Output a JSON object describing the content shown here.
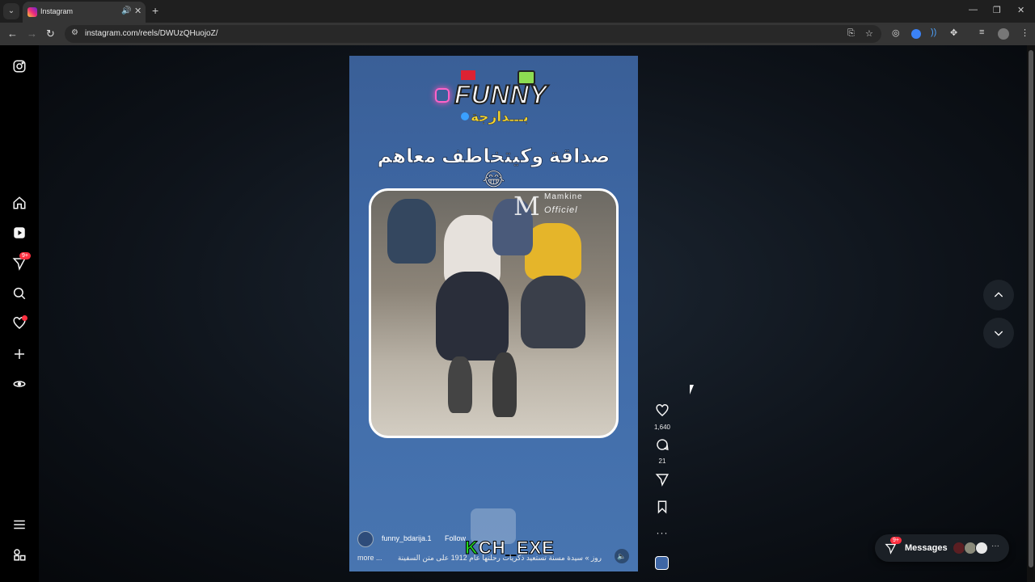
{
  "browser": {
    "tab_title": "Instagram",
    "url": "instagram.com/reels/DWUzQHuojoZ/"
  },
  "sidebar": {
    "notifications_badge": "9+",
    "icons": [
      "instagram-logo-icon",
      "home-icon",
      "reels-icon",
      "messages-icon",
      "search-icon",
      "heart-icon",
      "create-icon",
      "meta-ai-icon",
      "menu-icon",
      "also-from-meta-icon"
    ]
  },
  "reel": {
    "logo_text": "FUNNY",
    "logo_arabic": "بـــدارجة",
    "caption": "صداقة وكيتخاطف معاهم 😂",
    "watermark_letter": "M",
    "watermark_line1": "Mamkine",
    "watermark_line2": "Officiel",
    "username": "funny_bdarija.1",
    "follow_label": "Follow",
    "overlay_text_k": "K",
    "overlay_text_rest": "CH_EXE",
    "description": "روز » سيدة مسنة تستعيد ذكريات رحلتها عام 1912 على متن السفينة",
    "more_label": "more ..."
  },
  "actions": {
    "likes": "1,640",
    "comments": "21"
  },
  "messages": {
    "label": "Messages",
    "badge": "9+",
    "more": "···"
  },
  "colors": {
    "reel_bg": "#3f6aa8",
    "badge_red": "#ff3040",
    "logo_yellow": "#f4d530"
  }
}
